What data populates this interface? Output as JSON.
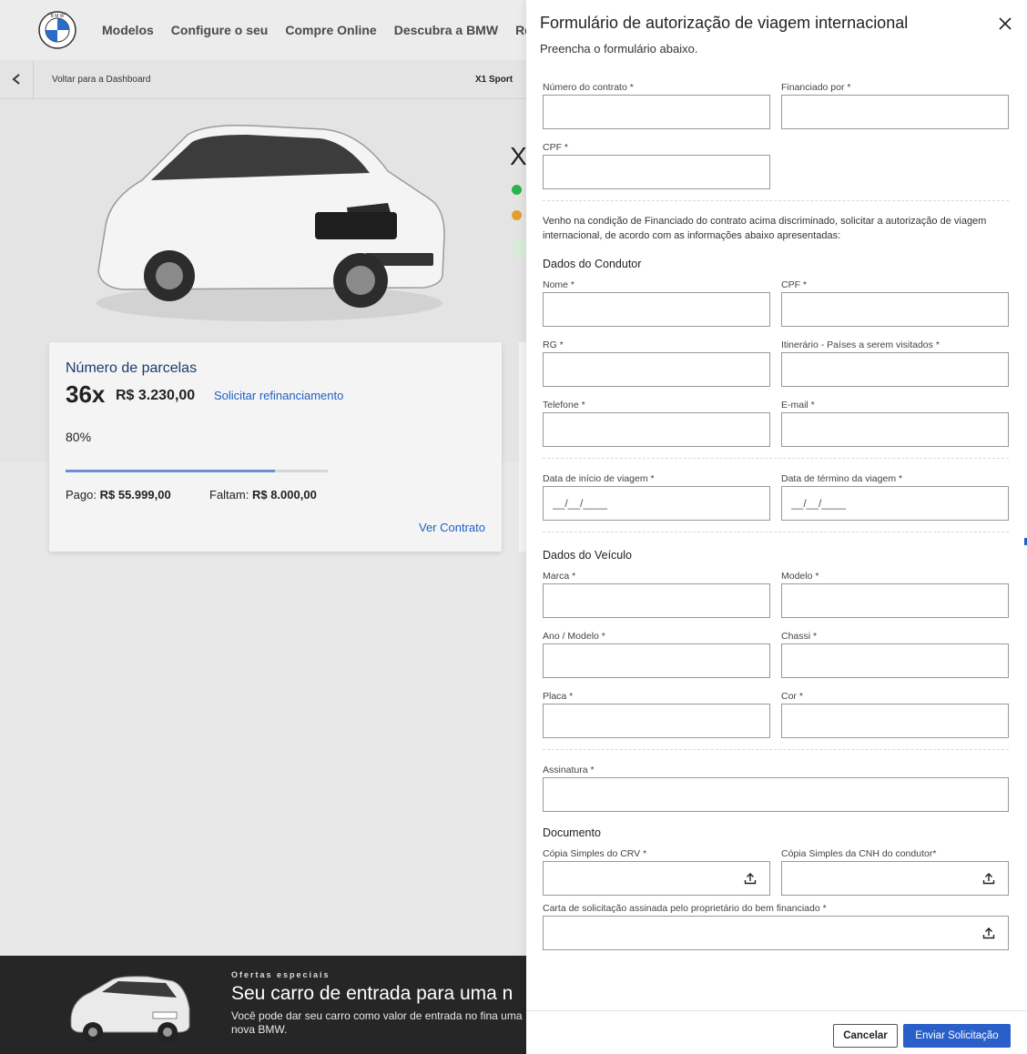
{
  "nav": {
    "links": [
      "Modelos",
      "Configure o seu",
      "Compre Online",
      "Descubra a BMW",
      "Recall"
    ]
  },
  "subbar": {
    "back_label": "Voltar para a Dashboard",
    "model": "X1 Sport"
  },
  "hero": {
    "partial_heading": "X",
    "dot_colors": [
      "#2eb34a",
      "#e0a030"
    ]
  },
  "installments_card": {
    "title": "Número de parcelas",
    "count": "36x",
    "amount": "R$ 3.230,00",
    "refinance_link": "Solicitar refinanciamento",
    "percent_label": "80%",
    "progress_fraction": 0.8,
    "paid_label": "Pago:",
    "paid_value": "R$ 55.999,00",
    "remaining_label": "Faltam:",
    "remaining_value": "R$ 8.000,00",
    "contract_link": "Ver Contrato"
  },
  "promo": {
    "kicker": "Ofertas especiais",
    "title": "Seu carro de entrada para uma n",
    "text": "Você pode dar seu carro como valor de entrada no fina uma nova BMW."
  },
  "modal": {
    "title": "Formulário de autorização de viagem internacional",
    "subtitle": "Preencha o formulário abaixo.",
    "fields": {
      "contract_number": "Número do contrato *",
      "financed_by": "Financiado por *",
      "cpf_top": "CPF *",
      "name": "Nome *",
      "cpf": "CPF *",
      "rg": "RG *",
      "itinerary": "Itinerário - Países a serem visitados *",
      "phone": "Telefone *",
      "email": "E-mail *",
      "trip_start": "Data de início de viagem *",
      "trip_end": "Data de término da viagem *",
      "date_placeholder": "__/__/____",
      "brand": "Marca *",
      "model": "Modelo *",
      "year_model": "Ano / Modelo *",
      "chassis": "Chassi *",
      "plate": "Placa *",
      "color": "Cor *",
      "signature": "Assinatura *",
      "crv_copy": "Cópia Simples do CRV *",
      "cnh_copy": "Cópia Simples da CNH do condutor*",
      "request_letter": "Carta de solicitação assinada pelo proprietário do bem financiado *"
    },
    "statement": "Venho na condição de Financiado do contrato acima discriminado, solicitar a autorização de viagem  internacional, de acordo com as informações abaixo apresentadas:",
    "sections": {
      "driver": "Dados do Condutor",
      "vehicle": "Dados do Veículo",
      "document": "Documento"
    },
    "buttons": {
      "cancel": "Cancelar",
      "submit": "Enviar Solicitação"
    },
    "accent_color": "#2a5fc9"
  }
}
